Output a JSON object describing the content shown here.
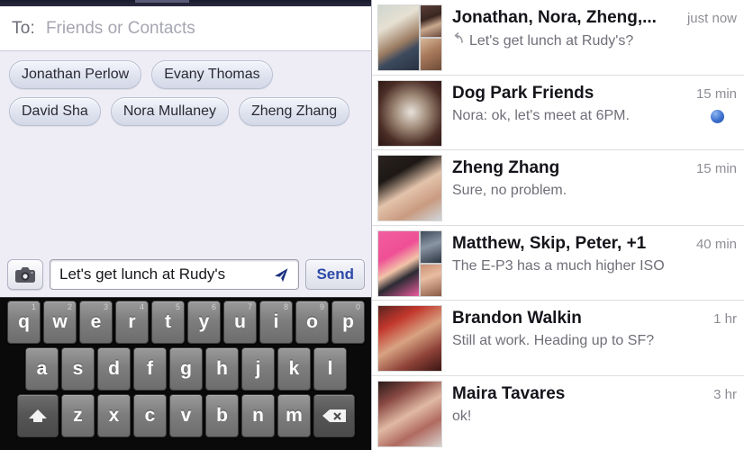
{
  "compose": {
    "to_label": "To:",
    "to_placeholder": "Friends or Contacts",
    "recipients": [
      {
        "name": "Jonathan Perlow"
      },
      {
        "name": "Evany Thomas"
      },
      {
        "name": "David Sha"
      },
      {
        "name": "Nora Mullaney"
      },
      {
        "name": "Zheng Zhang"
      }
    ],
    "camera_icon": "camera-icon",
    "message_value": "Let's get lunch at Rudy's",
    "location_icon": "paper-plane-icon",
    "send_label": "Send"
  },
  "keyboard": {
    "row1": [
      {
        "key": "q",
        "sup": "1"
      },
      {
        "key": "w",
        "sup": "2"
      },
      {
        "key": "e",
        "sup": "3"
      },
      {
        "key": "r",
        "sup": "4"
      },
      {
        "key": "t",
        "sup": "5"
      },
      {
        "key": "y",
        "sup": "6"
      },
      {
        "key": "u",
        "sup": "7"
      },
      {
        "key": "i",
        "sup": "8"
      },
      {
        "key": "o",
        "sup": "9"
      },
      {
        "key": "p",
        "sup": "0"
      }
    ],
    "row2": [
      {
        "key": "a"
      },
      {
        "key": "s"
      },
      {
        "key": "d"
      },
      {
        "key": "f"
      },
      {
        "key": "g"
      },
      {
        "key": "h"
      },
      {
        "key": "j"
      },
      {
        "key": "k"
      },
      {
        "key": "l"
      }
    ],
    "row3": [
      {
        "key": "z"
      },
      {
        "key": "x"
      },
      {
        "key": "c"
      },
      {
        "key": "v"
      },
      {
        "key": "b"
      },
      {
        "key": "n"
      },
      {
        "key": "m"
      }
    ],
    "shift_icon": "shift-icon",
    "backspace_icon": "backspace-icon"
  },
  "threads": [
    {
      "name": "Jonathan, Nora, Zheng,...",
      "time": "just now",
      "snippet": "Let's get lunch at Rudy's?",
      "reply_icon": "reply-arrow-icon",
      "has_reply_arrow": true,
      "unread": false,
      "group": true,
      "avatar": {
        "main": "ph-jon",
        "side": [
          "ph-dog1",
          "ph-kid"
        ]
      }
    },
    {
      "name": "Dog Park Friends",
      "time": "15 min",
      "snippet": "Nora: ok, let's meet at 6PM.",
      "has_reply_arrow": false,
      "unread": true,
      "group": false,
      "avatar": {
        "main": "ph-dog",
        "side": []
      }
    },
    {
      "name": "Zheng Zhang",
      "time": "15 min",
      "snippet": "Sure, no problem.",
      "has_reply_arrow": false,
      "unread": false,
      "group": false,
      "avatar": {
        "main": "ph-zhen",
        "side": []
      }
    },
    {
      "name": "Matthew, Skip, Peter, +1",
      "time": "40 min",
      "snippet": "The E-P3 has a much higher ISO",
      "has_reply_arrow": false,
      "unread": false,
      "group": true,
      "avatar": {
        "main": "ph-matt",
        "side": [
          "ph-skip",
          "ph-peter"
        ]
      }
    },
    {
      "name": "Brandon Walkin",
      "time": "1 hr",
      "snippet": "Still at work. Heading up to SF?",
      "has_reply_arrow": false,
      "unread": false,
      "group": false,
      "avatar": {
        "main": "ph-bran",
        "side": []
      }
    },
    {
      "name": "Maira Tavares",
      "time": "3 hr",
      "snippet": "ok!",
      "has_reply_arrow": false,
      "unread": false,
      "group": false,
      "avatar": {
        "main": "ph-maira",
        "side": []
      }
    }
  ],
  "colors": {
    "compose_bg": "#eeedf6",
    "send_blue": "#2d49a8",
    "unread_dot": "#3b6fd0",
    "keyboard_bg": "#0a0a0a"
  }
}
